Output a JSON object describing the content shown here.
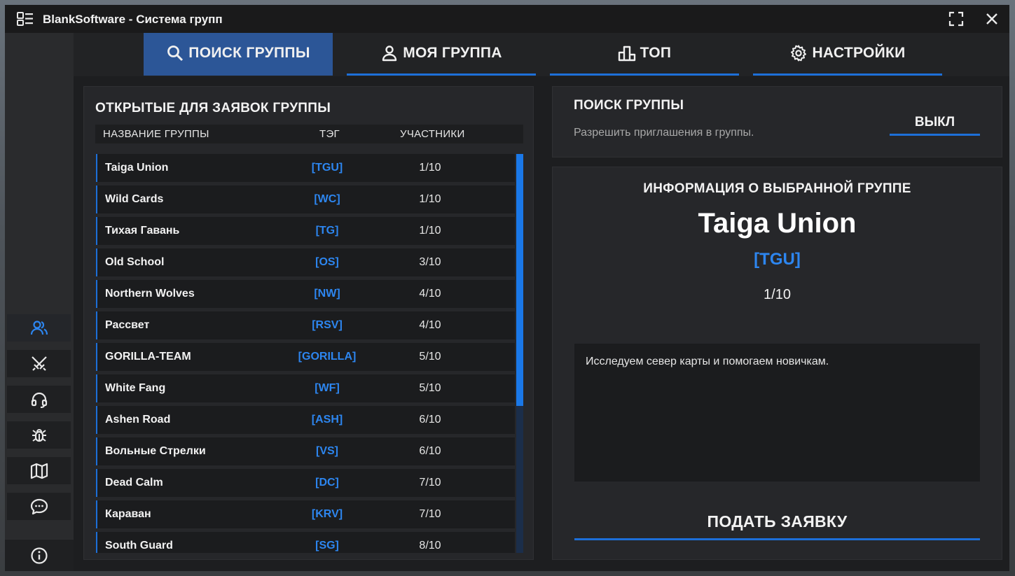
{
  "window": {
    "title": "BlankSoftware - Система групп"
  },
  "tabs": [
    {
      "label": "ПОИСК ГРУППЫ",
      "icon": "search-icon",
      "active": true
    },
    {
      "label": "МОЯ ГРУППА",
      "icon": "user-icon",
      "active": false
    },
    {
      "label": "ТОП",
      "icon": "podium-icon",
      "active": false
    },
    {
      "label": "НАСТРОЙКИ",
      "icon": "gear-icon",
      "active": false
    }
  ],
  "sidebar": {
    "items": [
      {
        "icon": "users-icon",
        "active": true
      },
      {
        "icon": "crossed-swords-icon",
        "active": false
      },
      {
        "icon": "headset-icon",
        "active": false
      },
      {
        "icon": "bug-icon",
        "active": false
      },
      {
        "icon": "map-icon",
        "active": false
      },
      {
        "icon": "chat-icon",
        "active": false
      }
    ],
    "bottom_icon": "info-icon"
  },
  "group_list": {
    "title": "ОТКРЫТЫЕ ДЛЯ ЗАЯВОК ГРУППЫ",
    "columns": {
      "name": "НАЗВАНИЕ ГРУППЫ",
      "tag": "ТЭГ",
      "members": "УЧАСТНИКИ"
    },
    "rows": [
      {
        "name": "Taiga Union",
        "tag": "[TGU]",
        "members": "1/10"
      },
      {
        "name": "Wild Cards",
        "tag": "[WC]",
        "members": "1/10"
      },
      {
        "name": "Тихая Гавань",
        "tag": "[TG]",
        "members": "1/10"
      },
      {
        "name": "Old School",
        "tag": "[OS]",
        "members": "3/10"
      },
      {
        "name": "Northern Wolves",
        "tag": "[NW]",
        "members": "4/10"
      },
      {
        "name": "Рассвет",
        "tag": "[RSV]",
        "members": "4/10"
      },
      {
        "name": "GORILLA-TEAM",
        "tag": "[GORILLA]",
        "members": "5/10"
      },
      {
        "name": "White Fang",
        "tag": "[WF]",
        "members": "5/10"
      },
      {
        "name": "Ashen Road",
        "tag": "[ASH]",
        "members": "6/10"
      },
      {
        "name": "Вольные Стрелки",
        "tag": "[VS]",
        "members": "6/10"
      },
      {
        "name": "Dead Calm",
        "tag": "[DC]",
        "members": "7/10"
      },
      {
        "name": "Караван",
        "tag": "[KRV]",
        "members": "7/10"
      },
      {
        "name": "South Guard",
        "tag": "[SG]",
        "members": "8/10"
      }
    ]
  },
  "search_settings": {
    "title": "ПОИСК ГРУППЫ",
    "description": "Разрешить приглашения в группы.",
    "toggle_label": "ВЫКЛ"
  },
  "selected_group": {
    "heading": "ИНФОРМАЦИЯ О ВЫБРАННОЙ ГРУППЕ",
    "name": "Taiga Union",
    "tag": "[TGU]",
    "members": "1/10",
    "description": "Исследуем север карты и помогаем новичкам.",
    "apply_label": "ПОДАТЬ ЗАЯВКУ"
  },
  "colors": {
    "accent": "#1d6fd8",
    "tag_blue": "#2d86f0",
    "active_tab": "#2c5697"
  }
}
